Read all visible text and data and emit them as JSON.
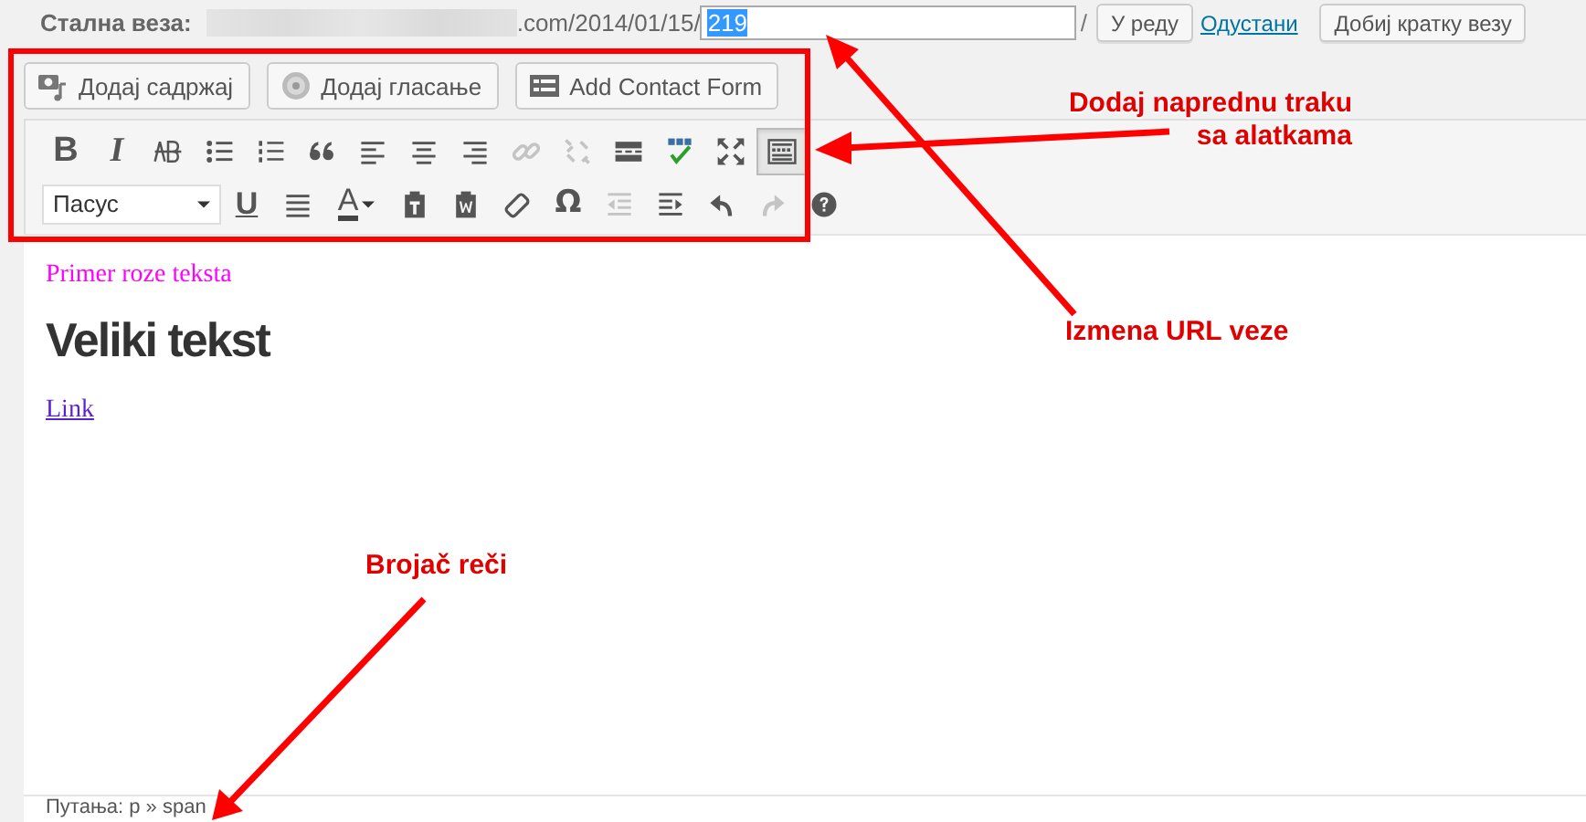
{
  "permalink": {
    "label": "Стална веза:",
    "url_suffix": ".com/2014/01/15/",
    "slug": "219",
    "trailing": "/",
    "actions": [
      {
        "kind": "button",
        "label": "У реду"
      },
      {
        "kind": "link",
        "label": "Одустани"
      },
      {
        "kind": "button",
        "label": "Добиј кратку везу"
      }
    ]
  },
  "media_buttons": [
    {
      "kind": "media",
      "label": "Додај садржај"
    },
    {
      "kind": "poll",
      "label": "Додај гласање"
    },
    {
      "kind": "form",
      "label": "Add Contact Form"
    }
  ],
  "toolbar_rows": [
    [
      {
        "kind": "bold",
        "label": "B",
        "selected": false,
        "disabled": false
      },
      {
        "kind": "italic",
        "label": "I",
        "selected": false,
        "disabled": false
      },
      {
        "kind": "strikethrough",
        "selected": false,
        "disabled": false
      },
      {
        "kind": "bullet-list",
        "selected": false,
        "disabled": false
      },
      {
        "kind": "numbered-list",
        "selected": false,
        "disabled": false
      },
      {
        "kind": "blockquote",
        "selected": false,
        "disabled": false
      },
      {
        "kind": "align-left",
        "selected": false,
        "disabled": false
      },
      {
        "kind": "align-center",
        "selected": false,
        "disabled": false
      },
      {
        "kind": "align-right",
        "selected": false,
        "disabled": false
      },
      {
        "kind": "link",
        "selected": false,
        "disabled": true
      },
      {
        "kind": "unlink",
        "selected": false,
        "disabled": true
      },
      {
        "kind": "read-more",
        "selected": false,
        "disabled": false
      },
      {
        "kind": "spellcheck",
        "disabled": false
      },
      {
        "kind": "fullscreen",
        "selected": false,
        "disabled": false
      },
      {
        "kind": "toolbar-toggle",
        "selected": true,
        "disabled": false
      }
    ],
    [
      {
        "kind": "format-select",
        "value": "Пасус"
      },
      {
        "kind": "underline",
        "label": "U",
        "selected": false,
        "disabled": false
      },
      {
        "kind": "justify",
        "selected": false,
        "disabled": false
      },
      {
        "kind": "text-color",
        "label": "A",
        "selected": false,
        "disabled": false
      },
      {
        "kind": "paste-text",
        "selected": false,
        "disabled": false
      },
      {
        "kind": "paste-word",
        "selected": false,
        "disabled": false
      },
      {
        "kind": "clear-formatting",
        "selected": false,
        "disabled": false
      },
      {
        "kind": "special-character",
        "label": "Ω",
        "selected": false,
        "disabled": false
      },
      {
        "kind": "outdent",
        "selected": false,
        "disabled": true
      },
      {
        "kind": "indent",
        "selected": false,
        "disabled": false
      },
      {
        "kind": "undo",
        "selected": false,
        "disabled": false
      },
      {
        "kind": "redo",
        "selected": false,
        "disabled": true
      },
      {
        "kind": "help",
        "selected": false,
        "disabled": false
      }
    ]
  ],
  "content": [
    {
      "kind": "paragraph",
      "text": "Primer roze teksta",
      "color": "#ff00ff"
    },
    {
      "kind": "heading",
      "text": "Veliki tekst"
    },
    {
      "kind": "link",
      "text": "Link"
    }
  ],
  "status_bar": {
    "path": "Путања: p » span"
  },
  "annotations": [
    {
      "kind": "toolbar-note",
      "lines": [
        "Dodaj naprednu traku",
        "sa alatkama"
      ]
    },
    {
      "kind": "url-note",
      "lines": [
        "Izmena URL veze"
      ]
    },
    {
      "kind": "counter-note",
      "lines": [
        "Brojač reči"
      ]
    }
  ]
}
